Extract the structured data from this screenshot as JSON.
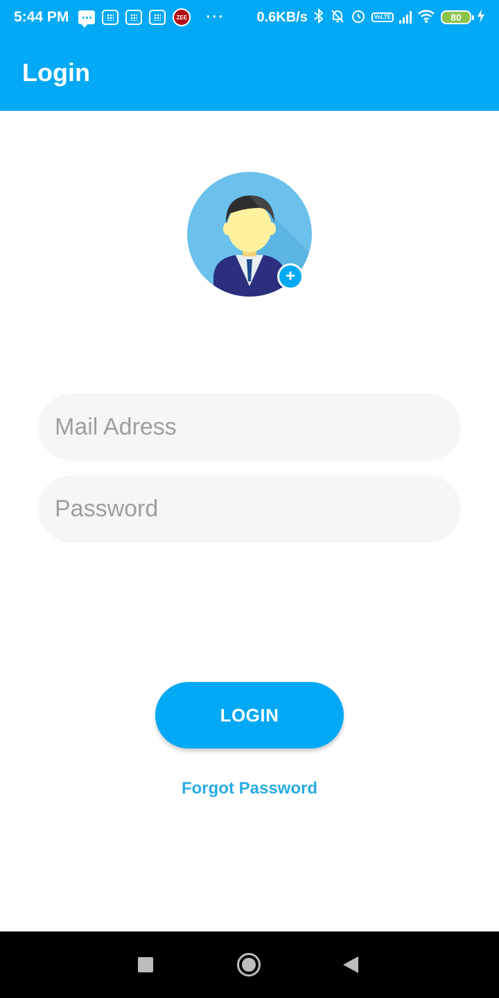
{
  "status_bar": {
    "time": "5:44 PM",
    "zee_label": "ZEE",
    "more": "···",
    "net_speed": "0.6KB/s",
    "volte": "VoLTE",
    "battery": "80"
  },
  "app_bar": {
    "title": "Login"
  },
  "avatar": {
    "add_symbol": "+"
  },
  "form": {
    "mail_placeholder": "Mail Adress",
    "password_placeholder": "Password"
  },
  "actions": {
    "login_label": "LOGIN",
    "forgot_label": "Forgot Password"
  },
  "colors": {
    "primary": "#03A9F4",
    "link": "#29ABE2",
    "field_bg": "#f6f6f6"
  }
}
